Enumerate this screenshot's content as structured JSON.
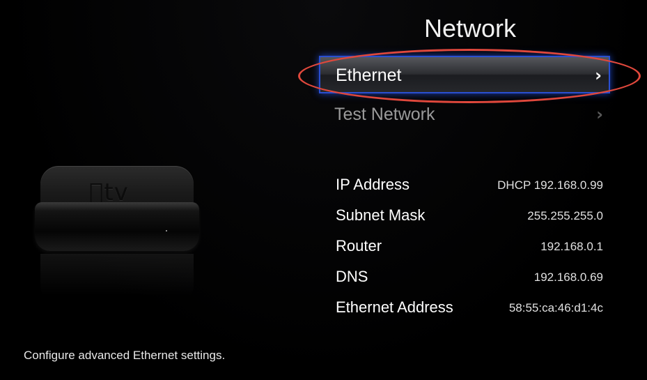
{
  "screen": {
    "title": "Network",
    "description": "Configure advanced Ethernet settings."
  },
  "device": {
    "logo_text": "tv",
    "logo_label": "Apple TV"
  },
  "menu": {
    "items": [
      {
        "label": "Ethernet",
        "selected": true,
        "chevron": "›"
      },
      {
        "label": "Test Network",
        "selected": false,
        "chevron": "›"
      }
    ]
  },
  "info": {
    "rows": [
      {
        "key": "IP Address",
        "value": "DHCP 192.168.0.99"
      },
      {
        "key": "Subnet Mask",
        "value": "255.255.255.0"
      },
      {
        "key": "Router",
        "value": "192.168.0.1"
      },
      {
        "key": "DNS",
        "value": "192.168.0.69"
      },
      {
        "key": "Ethernet Address",
        "value": "58:55:ca:46:d1:4c"
      }
    ]
  },
  "icons": {
    "chevron": "chevron-right-icon"
  },
  "colors": {
    "background": "#000000",
    "selection_border": "#2a4fd0",
    "annotation_ring": "#e0483c",
    "dimmed_text": "#9a9a9a"
  }
}
